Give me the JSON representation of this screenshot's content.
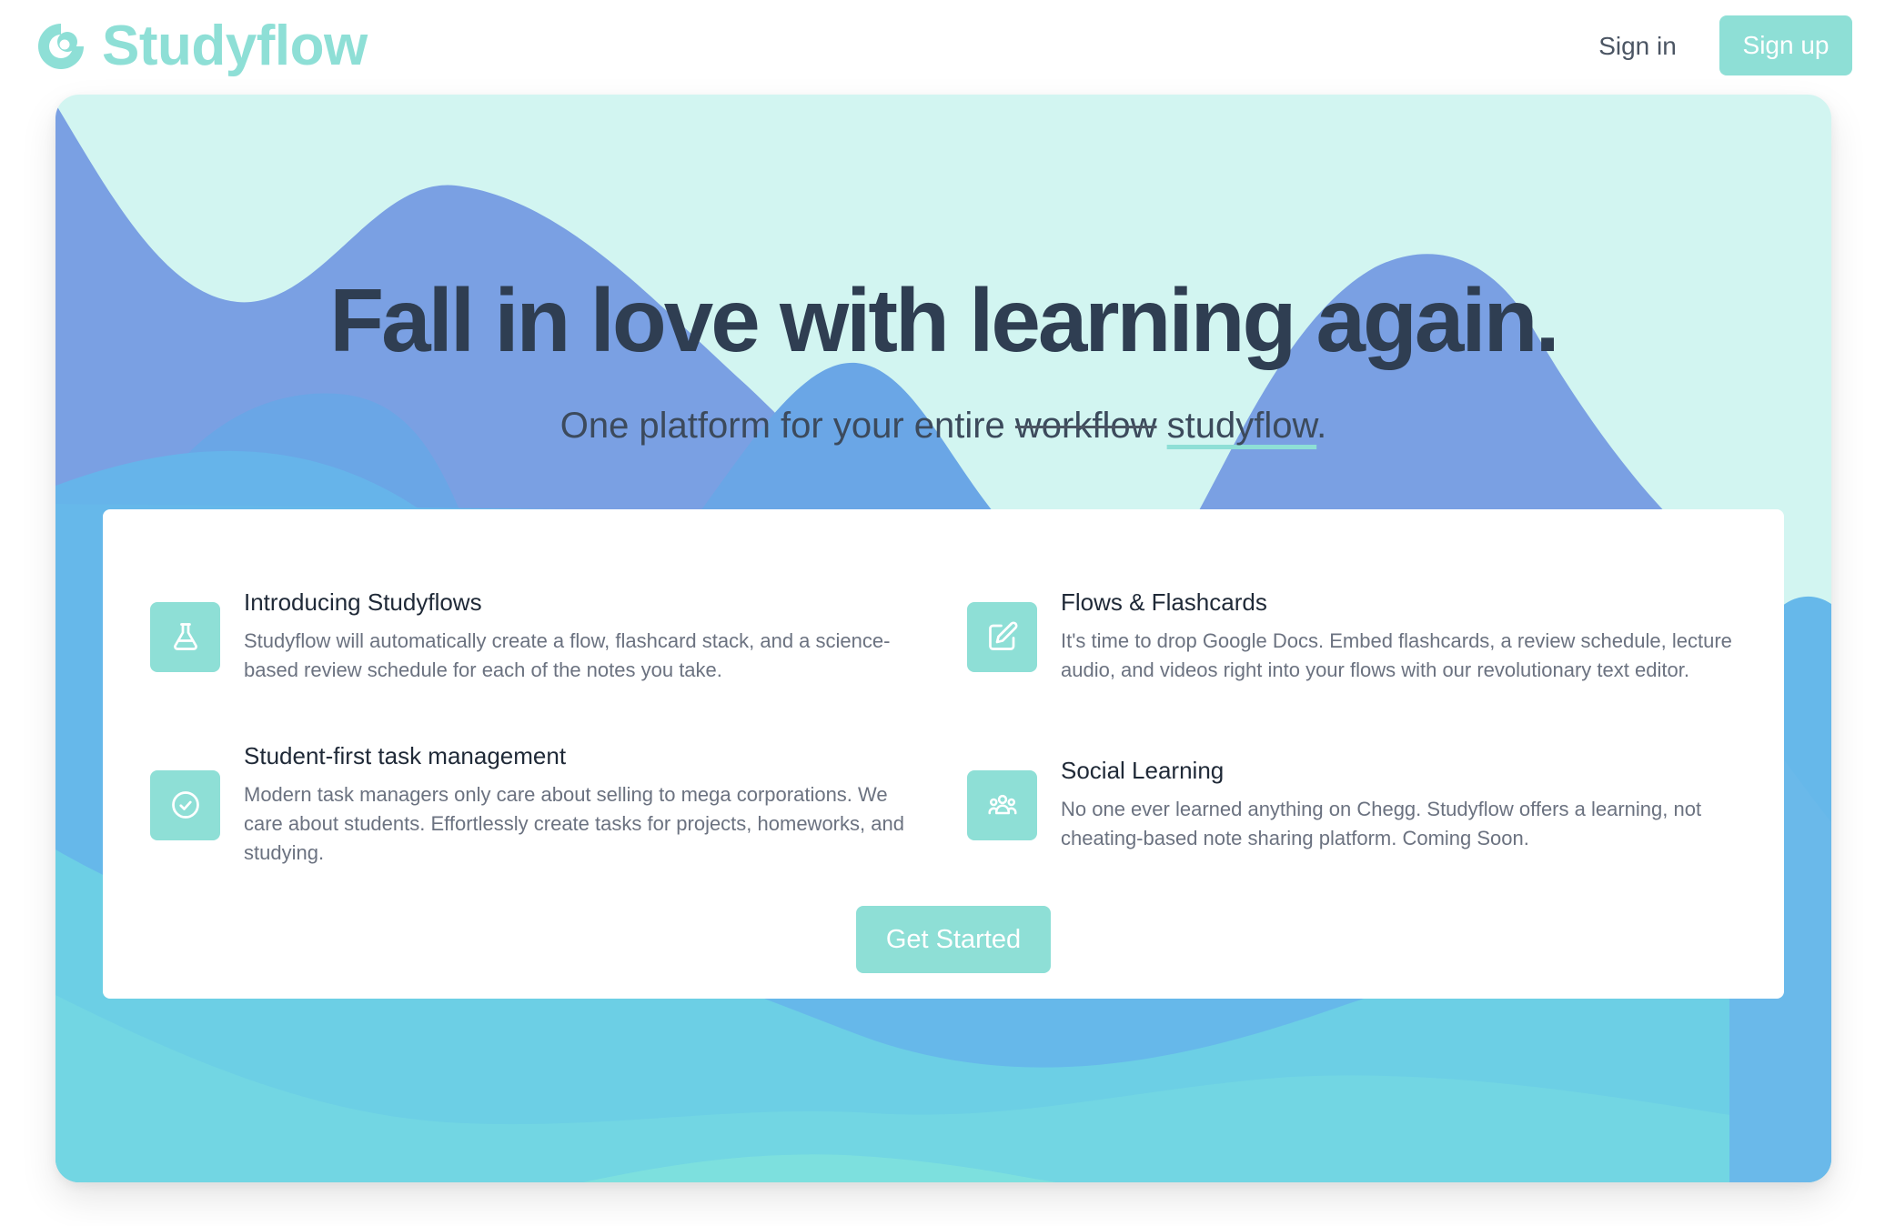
{
  "nav": {
    "brand_name": "Studyflow",
    "signin_label": "Sign in",
    "signup_label": "Sign up"
  },
  "hero": {
    "headline": "Fall in love with learning again.",
    "sub_prefix": "One platform for your entire ",
    "sub_strike": "workflow",
    "sub_space": " ",
    "sub_highlight": "studyflow",
    "sub_suffix": "."
  },
  "features": [
    {
      "icon": "beaker-icon",
      "title": "Introducing Studyflows",
      "description": "Studyflow will automatically create a flow, flashcard stack, and a science-based review schedule for each of the notes you take."
    },
    {
      "icon": "edit-icon",
      "title": "Flows & Flashcards",
      "description": "It's time to drop Google Docs. Embed flashcards, a review schedule, lecture audio, and videos right into your flows with our revolutionary text editor."
    },
    {
      "icon": "check-circle-icon",
      "title": "Student-first task management",
      "description": "Modern task managers only care about selling to mega corporations. We care about students. Effortlessly create tasks for projects, homeworks, and studying."
    },
    {
      "icon": "user-group-icon",
      "title": "Social Learning",
      "description": "No one ever learned anything on Chegg. Studyflow offers a learning, not cheating-based note sharing platform. Coming Soon."
    }
  ],
  "cta": {
    "label": "Get Started"
  },
  "colors": {
    "accent": "#8edfd6",
    "headline": "#2f3e52",
    "hero_bg": "#d2f5f1",
    "wave_indigo": "#7aa0e3",
    "wave_blue": "#62b6ea",
    "wave_cyan": "#6fd3e4"
  }
}
